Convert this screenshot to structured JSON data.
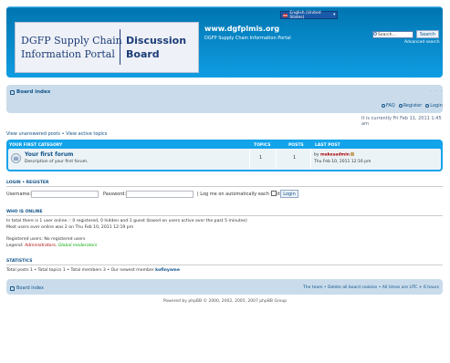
{
  "header": {
    "logo_left_line1": "DGFP Supply Chain",
    "logo_left_line2": "Information Portal",
    "logo_right_line1": "Discussion",
    "logo_right_line2": "Board",
    "site_title": "www.dgfplmis.org",
    "site_description": "DGFP Supply Chain Information Portal",
    "language": "English (United States)",
    "search_placeholder": "Search…",
    "search_button": "Search",
    "advanced_search": "Advanced search"
  },
  "navbar": {
    "board_index": "Board index",
    "font_size": "– – –",
    "faq": "FAQ",
    "register": "Register",
    "login": "Login"
  },
  "current_time": "It is currently Fri Feb 11, 2011 1:45 am",
  "search_links": "View unanswered posts • View active topics",
  "forum_table": {
    "category": "YOUR FIRST CATEGORY",
    "col_topics": "TOPICS",
    "col_posts": "POSTS",
    "col_last_post": "LAST POST",
    "forum_name": "Your first forum",
    "forum_description": "Description of your first forum.",
    "topics": "1",
    "posts": "1",
    "last_by_prefix": "by ",
    "last_user": "makesadmin",
    "last_time": "Thu Feb 10, 2011 12:16 pm"
  },
  "login": {
    "heading": "LOGIN • REGISTER",
    "username_label": "Username:",
    "password_label": "Password:",
    "remember_label": "| Log me on automatically each visit",
    "button": "Login"
  },
  "online": {
    "heading": "WHO IS ONLINE",
    "line1": "In total there is 1 user online :: 0 registered, 0 hidden and 1 guest (based on users active over the past 5 minutes)",
    "line2": "Most users ever online was 2 on Thu Feb 10, 2011 12:19 pm",
    "line3": "Registered users: No registered users",
    "legend_prefix": "Legend: ",
    "legend_admin": "Administrators",
    "legend_sep": ", ",
    "legend_mod": "Global moderators"
  },
  "statistics": {
    "heading": "STATISTICS",
    "line_prefix": "Total posts 1 • Total topics 1 • Total members 3 • Our newest member ",
    "newest_member": "kofinyame"
  },
  "footer": {
    "board_index": "Board index",
    "links": "The team • Delete all board cookies • All times are UTC + 6 hours",
    "copyright": "Powered by phpBB © 2000, 2002, 2005, 2007 phpBB Group"
  },
  "colors": {
    "header_blue": "#12A3EB",
    "nav_light": "#cadceb",
    "link": "#105289",
    "admin": "#AA0000",
    "moderator": "#00AA00"
  }
}
